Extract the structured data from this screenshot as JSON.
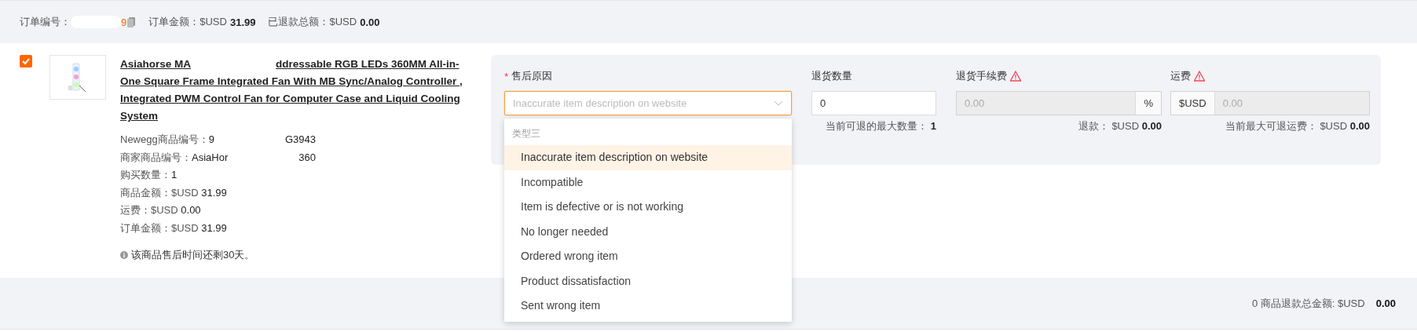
{
  "order_header": {
    "order_no_label": "订单编号：",
    "order_no_parts": [
      "9"
    ],
    "order_amount_label": "订单金额：",
    "order_amount_currency": "$USD",
    "order_amount": "31.99",
    "refunded_label": "已退款总额：",
    "refunded_currency": "$USD",
    "refunded_amount": "0.00"
  },
  "item": {
    "checked": true,
    "title_parts": [
      "Asiahorse MA",
      "ddressable RGB LEDs 360MM All-in-One Square Frame Integrated Fan With MB Sync/Analog Controller , Integrated PWM Control Fan for Computer Case and Liquid Cooling System"
    ],
    "details": [
      {
        "label": "Newegg商品编号：",
        "value_parts": [
          "9",
          "G3943"
        ]
      },
      {
        "label": "商家商品编号：",
        "value_parts": [
          "AsiaHor",
          "360"
        ]
      },
      {
        "label": "购买数量：",
        "value_parts": [
          "1"
        ]
      },
      {
        "label": "商品金额：",
        "currency": "$USD",
        "value_parts": [
          "31.99"
        ]
      },
      {
        "label": "运费：",
        "currency": "$USD",
        "value_parts": [
          "0.00"
        ]
      },
      {
        "label": "订单金额：",
        "currency": "$USD",
        "value_parts": [
          "31.99"
        ]
      }
    ],
    "note": "该商品售后时间还剩30天。"
  },
  "form": {
    "fields": [
      {
        "kind": "select",
        "label": "售后原因",
        "required_mark": "*",
        "disabled": false,
        "placeholder": "Inaccurate item description on website",
        "expanded": true,
        "group": "类型三",
        "options": [
          {
            "label": "Inaccurate item description on website",
            "selected": true
          },
          {
            "label": "Incompatible",
            "selected": false
          },
          {
            "label": "Item is defective or is not working",
            "selected": false
          },
          {
            "label": "No longer needed",
            "selected": false
          },
          {
            "label": "Ordered wrong item",
            "selected": false
          },
          {
            "label": "Product dissatisfaction",
            "selected": false
          },
          {
            "label": "Sent wrong item",
            "selected": false
          }
        ]
      },
      {
        "kind": "number",
        "label": "退货数量",
        "disabled": false,
        "value": "0",
        "hint_label": "当前可退的最大数量：",
        "hint_value": "1"
      },
      {
        "kind": "suffix",
        "label": "退货手续费",
        "warning": true,
        "disabled": true,
        "placeholder": "0.00",
        "addon": "%",
        "hint_label": "退款：",
        "hint_currency": "$USD",
        "hint_value": "0.00"
      },
      {
        "kind": "prefix",
        "label": "运费",
        "warning": true,
        "disabled": true,
        "placeholder": "0.00",
        "addon": "$USD",
        "hint_label": "当前最大可退运费：",
        "hint_currency": "$USD",
        "hint_value": "0.00"
      }
    ]
  },
  "footer": {
    "count": "0",
    "label": "商品退款总金额:",
    "currency": "$USD",
    "amount": "0.00"
  }
}
